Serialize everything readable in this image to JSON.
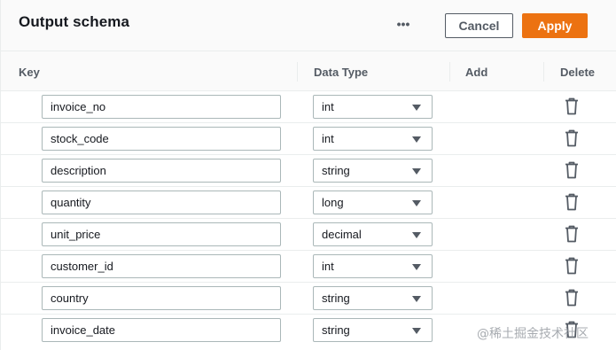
{
  "header": {
    "title": "Output schema",
    "more_label": "•••",
    "cancel_label": "Cancel",
    "apply_label": "Apply"
  },
  "columns": {
    "key": "Key",
    "data_type": "Data Type",
    "add": "Add",
    "delete": "Delete"
  },
  "rows": [
    {
      "key": "invoice_no",
      "type": "int"
    },
    {
      "key": "stock_code",
      "type": "int"
    },
    {
      "key": "description",
      "type": "string"
    },
    {
      "key": "quantity",
      "type": "long"
    },
    {
      "key": "unit_price",
      "type": "decimal"
    },
    {
      "key": "customer_id",
      "type": "int"
    },
    {
      "key": "country",
      "type": "string"
    },
    {
      "key": "invoice_date",
      "type": "string"
    }
  ],
  "icons": {
    "more": "ellipsis-icon",
    "select": "caret-down-icon",
    "delete": "trash-icon"
  },
  "colors": {
    "primary_button": "#ec7211",
    "text": "#16191f",
    "secondary_text": "#545b64",
    "border": "#aab7b8"
  },
  "watermark": "@稀土掘金技术社区"
}
